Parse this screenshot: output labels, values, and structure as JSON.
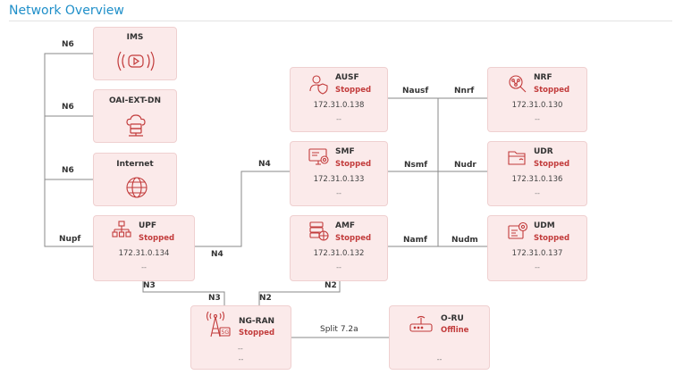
{
  "page": {
    "title": "Network Overview"
  },
  "colors": {
    "accent": "#1f8fc9",
    "node_bg": "#fbeaea",
    "status_red": "#c23b3b",
    "line": "#888888"
  },
  "links": {
    "n6_ims": "N6",
    "n6_oai": "N6",
    "n6_internet": "N6",
    "nupf": "Nupf",
    "n4_upf": "N4",
    "n4_smf": "N4",
    "n3_upf": "N3",
    "n3_ran": "N3",
    "n2_ran": "N2",
    "n2_amf": "N2",
    "nausf": "Nausf",
    "nsmf": "Nsmf",
    "namf": "Namf",
    "nnrf": "Nnrf",
    "nudr": "Nudr",
    "nudm": "Nudm",
    "split": "Split 7.2a"
  },
  "nodes": {
    "ims": {
      "name": "IMS",
      "icon": "broadcast-video-icon"
    },
    "oai": {
      "name": "OAI-EXT-DN",
      "icon": "cloud-server-icon"
    },
    "internet": {
      "name": "Internet",
      "icon": "globe-www-icon"
    },
    "upf": {
      "name": "UPF",
      "status": "Stopped",
      "ip": "172.31.0.134",
      "extra": "--",
      "icon": "network-nodes-icon"
    },
    "ausf": {
      "name": "AUSF",
      "status": "Stopped",
      "ip": "172.31.0.138",
      "extra": "--",
      "icon": "user-shield-icon"
    },
    "smf": {
      "name": "SMF",
      "status": "Stopped",
      "ip": "172.31.0.133",
      "extra": "--",
      "icon": "monitor-settings-icon"
    },
    "amf": {
      "name": "AMF",
      "status": "Stopped",
      "ip": "172.31.0.132",
      "extra": "--",
      "icon": "server-globe-icon"
    },
    "nrf": {
      "name": "NRF",
      "status": "Stopped",
      "ip": "172.31.0.130",
      "extra": "--",
      "icon": "search-nodes-icon"
    },
    "udr": {
      "name": "UDR",
      "status": "Stopped",
      "ip": "172.31.0.136",
      "extra": "--",
      "icon": "folder-icon"
    },
    "udm": {
      "name": "UDM",
      "status": "Stopped",
      "ip": "172.31.0.137",
      "extra": "--",
      "icon": "settings-card-icon"
    },
    "ngran": {
      "name": "NG-RAN",
      "status": "Stopped",
      "line1": "--",
      "line2": "--",
      "icon": "antenna-5g-icon"
    },
    "oru": {
      "name": "O-RU",
      "status": "Offline",
      "extra": "--",
      "icon": "router-icon"
    }
  }
}
